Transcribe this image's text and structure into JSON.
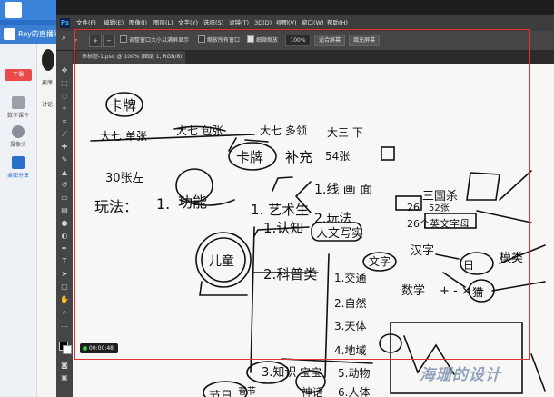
{
  "app": {
    "title": "Roy的直播间(",
    "side_red_button": "下课",
    "side_items": [
      "数字课件",
      "摄像头",
      "桌面分享"
    ],
    "panel_text_1": "麦序",
    "panel_text_2": "讨论"
  },
  "photoshop": {
    "logo": "Ps",
    "menu": [
      "文件(F)",
      "编辑(E)",
      "图像(I)",
      "图层(L)",
      "文字(Y)",
      "选择(S)",
      "滤镜(T)",
      "3D(D)",
      "视图(V)",
      "窗口(W)",
      "帮助(H)"
    ],
    "options": {
      "resize_windows": "调整窗口大小以满屏显示",
      "zoom_all": "缩放所有窗口",
      "scrubby_zoom": "细微缩放",
      "zoom_value": "100%",
      "fit_screen": "适合屏幕",
      "fill_screen": "填充屏幕"
    },
    "tab_label": "未标题-1.psd @ 100% (图层 1, RGB/8) ×",
    "tools": [
      "move-icon",
      "marquee-icon",
      "lasso-icon",
      "magic-wand-icon",
      "crop-icon",
      "eyedropper-icon",
      "healing-icon",
      "brush-icon",
      "stamp-icon",
      "history-brush-icon",
      "eraser-icon",
      "gradient-icon",
      "blur-icon",
      "dodge-icon",
      "pen-icon",
      "type-icon",
      "path-select-icon",
      "shape-icon",
      "hand-icon",
      "zoom-icon",
      "more-icon"
    ],
    "colors": {
      "accent": "#e53030",
      "record_dot": "#2ecc40"
    }
  },
  "sketch": {
    "t1": "卡牌",
    "t2": "大七 单张",
    "t3": "大七 包张",
    "t4": "大七 多领",
    "t5": "大三 下",
    "t6": "卡牌",
    "t7": "补充",
    "t8": "54张",
    "t9": "30张左",
    "t10": "玩法：",
    "t11": "1.",
    "t12": "功能",
    "t13": "1. 艺术生",
    "t14": "1.线 画 面",
    "t15": "2.玩法",
    "t16": "三国杀",
    "t17": "26",
    "t18": "52张",
    "t19": "26个英文字母",
    "t20": "1.认知",
    "t21": "人文写实",
    "t22": "文字",
    "t23": "汉字",
    "t24": "儿童",
    "t25": "2.科普类",
    "t26": "1.交通",
    "t27": "2.自然",
    "t28": "3.天体",
    "t29": "4.地域",
    "t30": "5.动物",
    "t31": "数学",
    "t32": "+ - × ÷",
    "t33": "3.知识",
    "t34": "宝宝",
    "t35": "神话",
    "t36": "春节",
    "t37": "节日",
    "t38": "兄弟",
    "t39": "6.人体",
    "t40": "日",
    "t41": "猫",
    "t42": "模类"
  },
  "recording": {
    "timer": "00:00:48"
  },
  "watermark": "海珊的设计"
}
